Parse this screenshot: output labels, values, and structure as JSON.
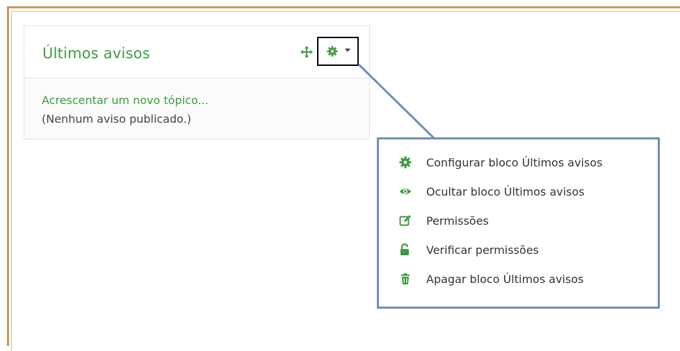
{
  "block": {
    "title": "Últimos avisos",
    "add_link": "Acrescentar um novo tópico...",
    "empty_message": "(Nenhum aviso publicado.)"
  },
  "menu": {
    "items": [
      {
        "label": "Configurar bloco Últimos avisos",
        "icon": "gear-icon"
      },
      {
        "label": "Ocultar bloco Últimos avisos",
        "icon": "eye-icon"
      },
      {
        "label": "Permissões",
        "icon": "edit-icon"
      },
      {
        "label": "Verificar permissões",
        "icon": "unlock-icon"
      },
      {
        "label": "Apagar bloco Últimos avisos",
        "icon": "trash-icon"
      }
    ]
  },
  "colors": {
    "accent": "#3e9b3e",
    "frame": "#c59a5a",
    "callout": "#6d8cc0"
  }
}
